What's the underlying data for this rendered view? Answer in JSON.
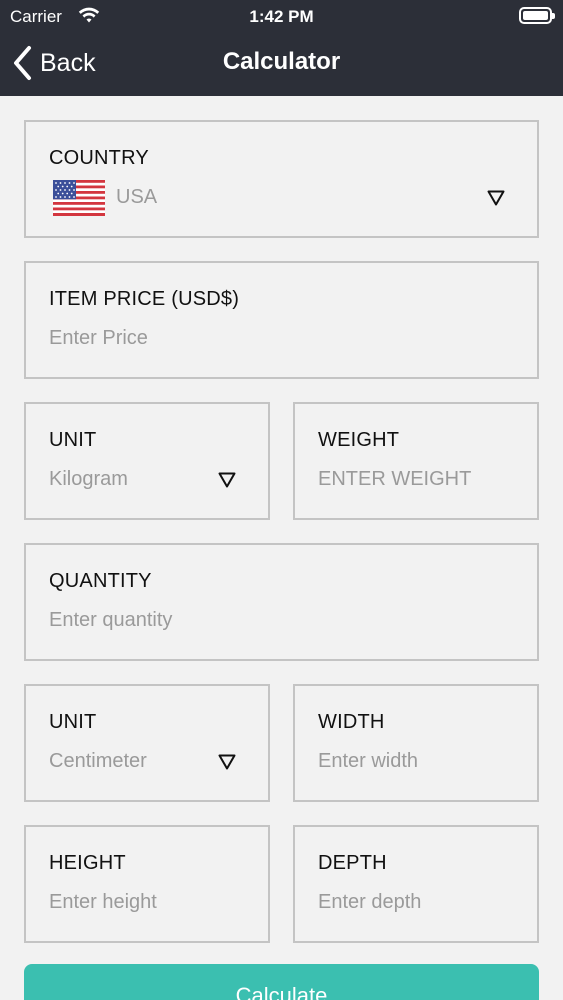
{
  "status_bar": {
    "carrier": "Carrier",
    "time": "1:42 PM"
  },
  "nav": {
    "back_label": "Back",
    "title": "Calculator"
  },
  "form": {
    "country": {
      "label": "COUNTRY",
      "value": "USA",
      "flag_icon": "us-flag-icon"
    },
    "item_price": {
      "label": "ITEM PRICE (USD$)",
      "placeholder": "Enter Price"
    },
    "weight_unit": {
      "label": "UNIT",
      "value": "Kilogram"
    },
    "weight": {
      "label": "WEIGHT",
      "placeholder": "ENTER WEIGHT"
    },
    "quantity": {
      "label": "QUANTITY",
      "placeholder": "Enter quantity"
    },
    "dimension_unit": {
      "label": "UNIT",
      "value": "Centimeter"
    },
    "width": {
      "label": "WIDTH",
      "placeholder": "Enter width"
    },
    "height": {
      "label": "HEIGHT",
      "placeholder": "Enter height"
    },
    "depth": {
      "label": "DEPTH",
      "placeholder": "Enter depth"
    }
  },
  "calculate_label": "Calculate",
  "colors": {
    "header_bg": "#2c2f38",
    "accent": "#3bbfb0",
    "field_border": "#c4c4c4",
    "placeholder": "#9a9a9a"
  }
}
